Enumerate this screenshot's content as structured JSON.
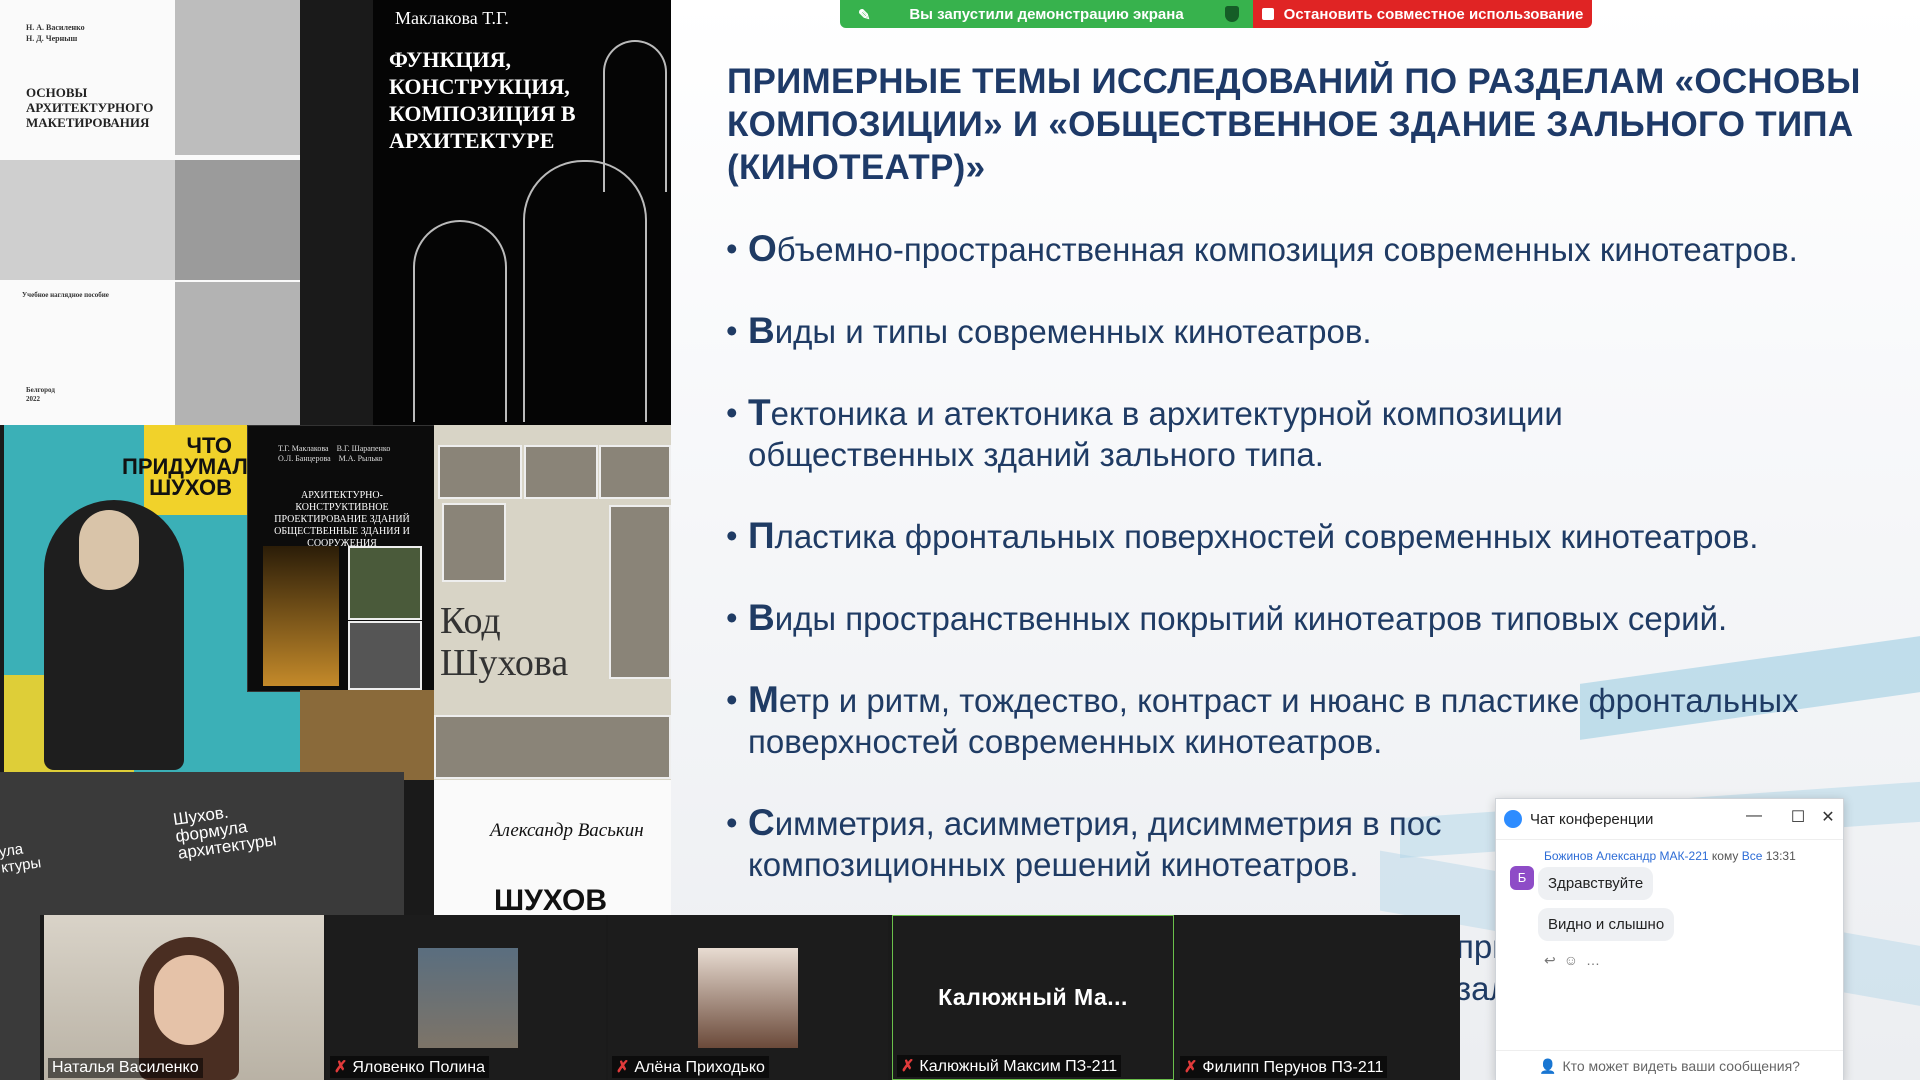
{
  "share_bar": {
    "status": "Вы запустили демонстрацию экрана",
    "stop": "Остановить совместное использование"
  },
  "slide": {
    "title": "ПРИМЕРНЫЕ ТЕМЫ ИССЛЕДОВАНИЙ ПО РАЗДЕЛАМ «ОСНОВЫ КОМПОЗИЦИИ» И «ОБЩЕСТВЕННОЕ ЗДАНИЕ ЗАЛЬНОГО ТИПА (КИНОТЕАТР)»",
    "topics": [
      {
        "first": "О",
        "rest": "бъемно-пространственная композиция современных кинотеатров."
      },
      {
        "first": "В",
        "rest": "иды и типы современных кинотеатров."
      },
      {
        "first": "Т",
        "rest": "ектоника и атектоника в архитектурной композиции",
        "line2": "общественных зданий зального типа."
      },
      {
        "first": "П",
        "rest": "ластика фронтальных поверхностей современных кинотеатров."
      },
      {
        "first": "В",
        "rest": "иды пространственных покрытий кинотеатров типовых серий."
      },
      {
        "first": "М",
        "rest": "етр и ритм, тождество, контраст и нюанс в пластике фронтальных",
        "line2": "поверхностей современных кинотеатров."
      },
      {
        "first": "С",
        "rest": "имметрия, асимметрия, дисимметрия в пос",
        "line2": "композиционных решений кинотеатров."
      }
    ],
    "cut1": "при",
    "cut2": "зал"
  },
  "books": {
    "b1_author": "Н. А. Василенко\nН. Д. Черныш",
    "b1_title": "ОСНОВЫ АРХИТЕКТУРНОГО МАКЕТИРОВАНИЯ",
    "b1_sub": "Учебное наглядное пособие",
    "b1_city": "Белгород\n2022",
    "b2_author": "Маклакова Т.Г.",
    "b2_title": "ФУНКЦИЯ, КОНСТРУКЦИЯ, КОМПОЗИЦИЯ В АРХИТЕКТУРЕ",
    "b3_title": "ЧТО ПРИДУМАЛ ШУХОВ",
    "b4_authors": "Т.Г. Маклакова    В.Г. Шарапенко\nО.Л. Банцерова    М.А. Рылько",
    "b4_title": "АРХИТЕКТУРНО-КОНСТРУКТИВНОЕ ПРОЕКТИРОВАНИЕ ЗДАНИЙ\nОБЩЕСТВЕННЫЕ ЗДАНИЯ И СООРУЖЕНИЯ",
    "b5_title": "Код Шухова",
    "b7_title": "Шухов. формула архитектуры",
    "b7_title2": "ула\nктуры",
    "b8_author": "Александр Васькин",
    "b8_title": "ШУХОВ"
  },
  "participants": [
    {
      "name": "Наталья Василенко",
      "muted": false
    },
    {
      "name": "Яловенко Полина",
      "muted": true
    },
    {
      "name": "Алёна Приходько",
      "muted": true
    },
    {
      "name": "Калюжный Максим ПЗ-211",
      "muted": true,
      "tile_text": "Калюжный  Ма..."
    },
    {
      "name": "Филипп Перунов ПЗ-211",
      "muted": true
    }
  ],
  "chat": {
    "title": "Чат конференции",
    "sender": "Божинов Александр МАК-221",
    "to_word": "кому",
    "recipient": "Все",
    "time": "13:31",
    "avatar_letter": "Б",
    "messages": [
      "Здравствуйте",
      "Видно и слышно"
    ],
    "footer": "Кто может видеть ваши сообщения?"
  },
  "colors": {
    "accent_title": "#1e3a68",
    "share_green": "#37b24d",
    "share_red": "#e02424",
    "zoom_blue": "#2d8cff"
  }
}
